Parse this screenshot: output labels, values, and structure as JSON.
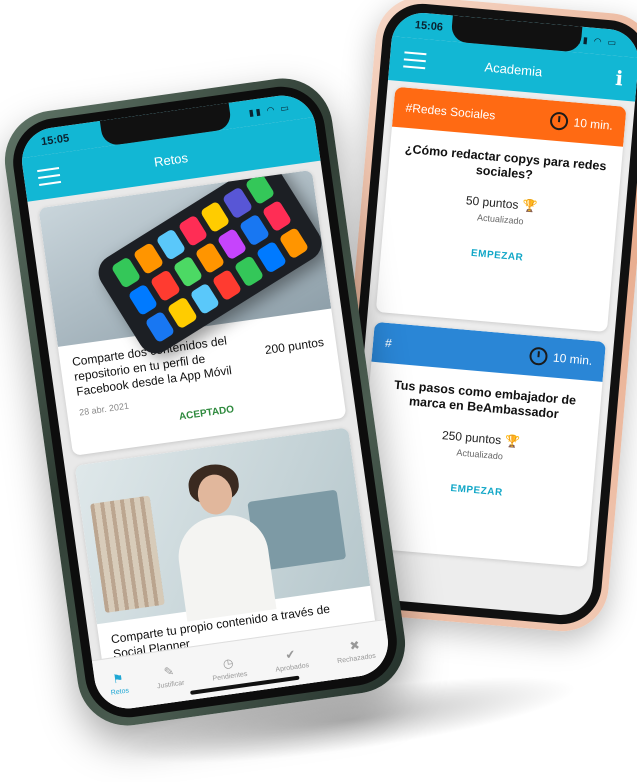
{
  "academy_screen": {
    "time": "15:06",
    "title": "Academia",
    "info_label": "i",
    "courses": [
      {
        "category": "#Redes Sociales",
        "duration": "10 min.",
        "color": "#ff6a13",
        "title": "¿Cómo redactar copys para redes sociales?",
        "points": "50 puntos",
        "updated": "Actualizado",
        "action": "EMPEZAR"
      },
      {
        "category": "#",
        "duration": "10 min.",
        "color": "#2a86d6",
        "title": "Tus pasos como embajador de marca en BeAmbassador",
        "points": "250 puntos",
        "updated": "Actualizado",
        "action": "EMPEZAR"
      }
    ]
  },
  "challenges_screen": {
    "time": "15:05",
    "title": "Retos",
    "challenges": [
      {
        "title": "Comparte dos contenidos del repositorio en tu perfil de Facebook desde la App Móvil",
        "points": "200 puntos",
        "date": "28 abr. 2021",
        "status": "ACEPTADO"
      },
      {
        "title": "Comparte tu propio contenido a través de Social Planner"
      }
    ],
    "nav": [
      {
        "label": "Retos",
        "icon": "flag-icon",
        "active": true
      },
      {
        "label": "Justificar",
        "icon": "pencil-icon",
        "active": false
      },
      {
        "label": "Pendientes",
        "icon": "clock-icon",
        "active": false
      },
      {
        "label": "Aprobados",
        "icon": "check-icon",
        "active": false
      },
      {
        "label": "Rechazados",
        "icon": "x-icon",
        "active": false
      }
    ]
  },
  "colors": {
    "accent": "#12b7d4",
    "accepted": "#2f8a3e",
    "orange_header": "#ff6a13",
    "blue_header": "#2a86d6"
  }
}
